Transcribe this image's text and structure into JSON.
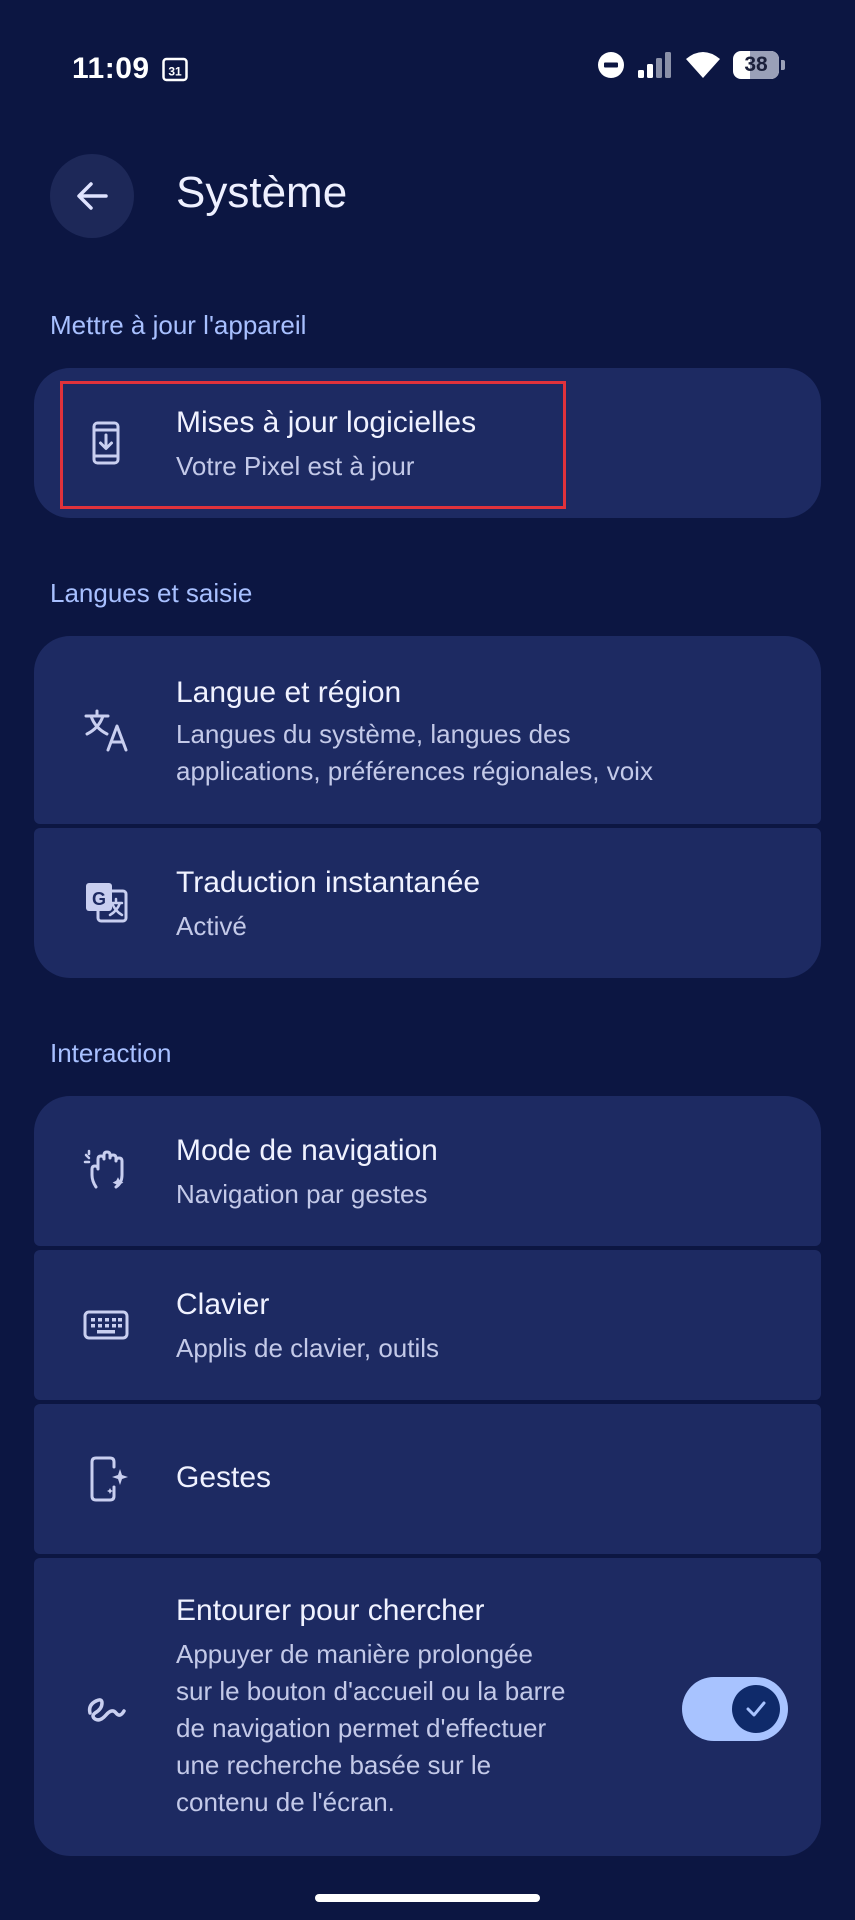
{
  "status_bar": {
    "time": "11:09",
    "calendar_day": "31",
    "battery_level": "38",
    "battery_percent": 38
  },
  "app_bar": {
    "title": "Système"
  },
  "sections": {
    "update": {
      "header": "Mettre à jour l'appareil",
      "software_updates": {
        "title": "Mises à jour logicielles",
        "subtitle": "Votre Pixel est à jour"
      }
    },
    "languages": {
      "header": "Langues et saisie",
      "language_region": {
        "title": "Langue et région",
        "subtitle_line1": "Langues du système, langues des",
        "subtitle_line2": "applications, préférences régionales, voix"
      },
      "live_translate": {
        "title": "Traduction instantanée",
        "subtitle": "Activé"
      }
    },
    "interaction": {
      "header": "Interaction",
      "navigation_mode": {
        "title": "Mode de navigation",
        "subtitle": "Navigation par gestes"
      },
      "keyboard": {
        "title": "Clavier",
        "subtitle": "Applis de clavier, outils"
      },
      "gestures": {
        "title": "Gestes"
      },
      "circle_to_search": {
        "title": "Entourer pour chercher",
        "subtitle_line1": "Appuyer de manière prolongée",
        "subtitle_line2": "sur le bouton d'accueil ou la barre",
        "subtitle_line3": "de navigation permet d'effectuer",
        "subtitle_line4": "une recherche basée sur le",
        "subtitle_line5": "contenu de l'écran.",
        "enabled": true
      }
    }
  },
  "colors": {
    "background": "#0c1642",
    "card": "#1d2a62",
    "accent": "#a8c0ff",
    "highlight": "#e0323b"
  }
}
